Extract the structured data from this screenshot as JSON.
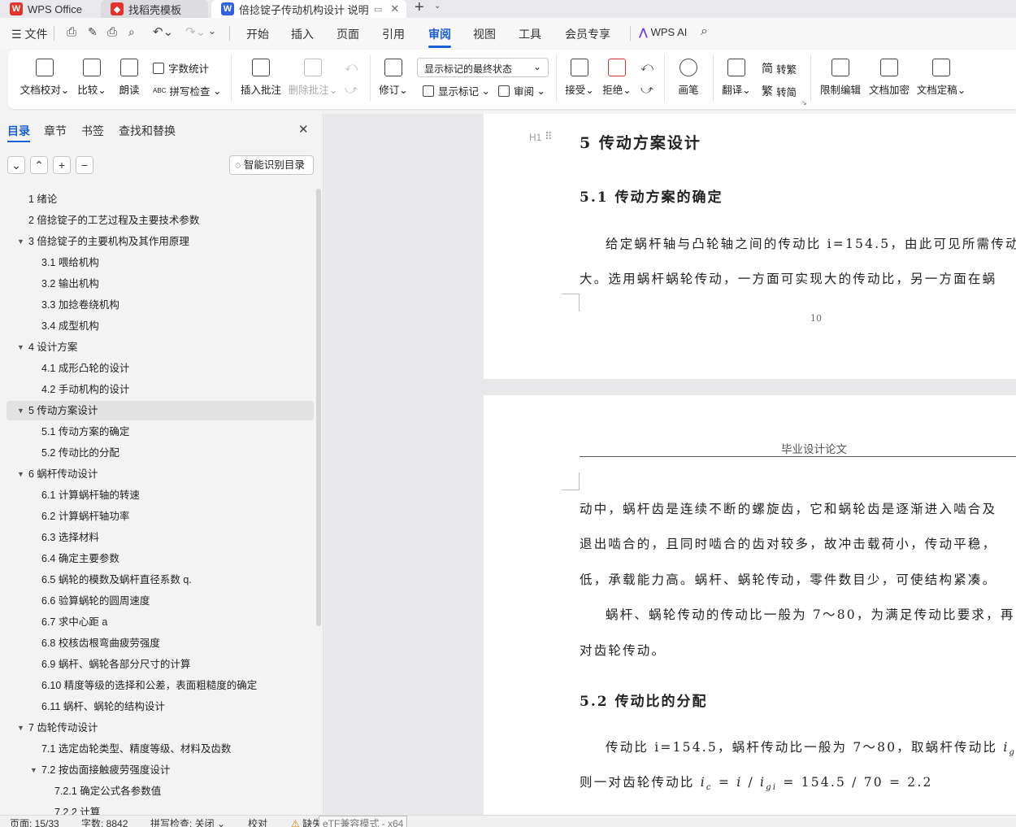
{
  "tabs": {
    "app": "WPS Office",
    "templates": "找稻壳模板",
    "document": "倍捻锭子传动机构设计 说明书"
  },
  "menu": {
    "file": "文件",
    "items": [
      "开始",
      "插入",
      "页面",
      "引用",
      "审阅",
      "视图",
      "工具",
      "会员专享"
    ],
    "ai": "WPS AI"
  },
  "ribbon": {
    "doc_proof": "文档校对",
    "compare": "比较",
    "read_aloud": "朗读",
    "word_count": "字数统计",
    "spell_check": "拼写检查",
    "insert_comment": "插入批注",
    "delete_comment": "删除批注",
    "revise": "修订",
    "markup_select": "显示标记的最终状态",
    "show_markup": "显示标记",
    "review": "审阅",
    "accept": "接受",
    "reject": "拒绝",
    "ink": "画笔",
    "translate": "翻译",
    "to_traditional": "转繁",
    "to_simplified": "转简",
    "restrict_edit": "限制编辑",
    "encrypt": "文档加密",
    "finalize": "文档定稿"
  },
  "sidebar": {
    "tabs": [
      "目录",
      "章节",
      "书签",
      "查找和替换"
    ],
    "smart_toc": "智能识别目录",
    "toc": [
      {
        "label": "1  绪论",
        "level": 1,
        "arrow": ""
      },
      {
        "label": "2  倍捻锭子的工艺过程及主要技术参数",
        "level": 1,
        "arrow": ""
      },
      {
        "label": "3  倍捻锭子的主要机构及其作用原理",
        "level": 1,
        "arrow": "▼"
      },
      {
        "label": "3.1  喂给机构",
        "level": 2,
        "arrow": ""
      },
      {
        "label": "3.2  输出机构",
        "level": 2,
        "arrow": ""
      },
      {
        "label": "3.3  加捻卷绕机构",
        "level": 2,
        "arrow": ""
      },
      {
        "label": "3.4  成型机构",
        "level": 2,
        "arrow": ""
      },
      {
        "label": "4  设计方案",
        "level": 1,
        "arrow": "▼"
      },
      {
        "label": "4.1  成形凸轮的设计",
        "level": 2,
        "arrow": ""
      },
      {
        "label": "4.2  手动机构的设计",
        "level": 2,
        "arrow": ""
      },
      {
        "label": "5  传动方案设计",
        "level": 1,
        "arrow": "▼",
        "active": true
      },
      {
        "label": "5.1  传动方案的确定",
        "level": 2,
        "arrow": ""
      },
      {
        "label": "5.2  传动比的分配",
        "level": 2,
        "arrow": ""
      },
      {
        "label": "6  蜗杆传动设计",
        "level": 1,
        "arrow": "▼"
      },
      {
        "label": "6.1  计算蜗杆轴的转速",
        "level": 2,
        "arrow": ""
      },
      {
        "label": "6.2  计算蜗杆轴功率",
        "level": 2,
        "arrow": ""
      },
      {
        "label": "6.3  选择材料",
        "level": 2,
        "arrow": ""
      },
      {
        "label": "6.4  确定主要参数",
        "level": 2,
        "arrow": ""
      },
      {
        "label": "6.5  蜗轮的模数及蜗杆直径系数 q.",
        "level": 2,
        "arrow": ""
      },
      {
        "label": "6.6  验算蜗轮的圆周速度",
        "level": 2,
        "arrow": ""
      },
      {
        "label": "6.7  求中心距 a",
        "level": 2,
        "arrow": ""
      },
      {
        "label": "6.8  校核齿根弯曲疲劳强度",
        "level": 2,
        "arrow": ""
      },
      {
        "label": "6.9  蜗杆、蜗轮各部分尺寸的计算",
        "level": 2,
        "arrow": ""
      },
      {
        "label": "6.10  精度等级的选择和公差，表面粗糙度的确定",
        "level": 2,
        "arrow": ""
      },
      {
        "label": "6.11  蜗杆、蜗轮的结构设计",
        "level": 2,
        "arrow": ""
      },
      {
        "label": "7  齿轮传动设计",
        "level": 1,
        "arrow": "▼"
      },
      {
        "label": "7.1  选定齿轮类型、精度等级、材料及齿数",
        "level": 2,
        "arrow": ""
      },
      {
        "label": "7.2  按齿面接触疲劳强度设计",
        "level": 2,
        "arrow": "▼"
      },
      {
        "label": "7.2.1  确定公式各参数值",
        "level": 3,
        "arrow": ""
      },
      {
        "label": "7.2.2  计算",
        "level": 3,
        "arrow": ""
      }
    ]
  },
  "document": {
    "h1_marker": "H1",
    "h1": "5 传动方案设计",
    "h2_1": "5.1 传动方案的确定",
    "p1_line1": "给定蜗杆轴与凸轮轴之间的传动比 i=154.5，由此可见所需传动",
    "p1_line2": "大。选用蜗杆蜗轮传动，一方面可实现大的传动比，另一方面在蜗",
    "page_number": "10",
    "header": "毕业设计论文",
    "p2_line1": "动中，蜗杆齿是连续不断的螺旋齿，它和蜗轮齿是逐渐进入啮合及",
    "p2_line2": "退出啮合的，且同时啮合的齿对较多，故冲击载荷小，传动平稳，",
    "p2_line3": "低，承载能力高。蜗杆、蜗轮传动，零件数目少，可使结构紧凑。",
    "p3_line1": "蜗杆、蜗轮传动的传动比一般为 7～80，为满足传动比要求，再",
    "p3_line2": "对齿轮传动。",
    "h2_2": "5.2 传动比的分配",
    "p4_line1": "传动比 i=154.5，蜗杆传动比一般为 7～80，取蜗杆传动比",
    "p4_line2_prefix": "则一对齿轮传动比",
    "formula": "= 154.5 / 70 = 2.2"
  },
  "status": {
    "page": "页面: 15/33",
    "words": "字数: 8842",
    "spell": "拼写检查: 关闭",
    "proof": "校对",
    "missing_font": "缺失字体",
    "overlay": "eTF兼容模式 - x64"
  }
}
